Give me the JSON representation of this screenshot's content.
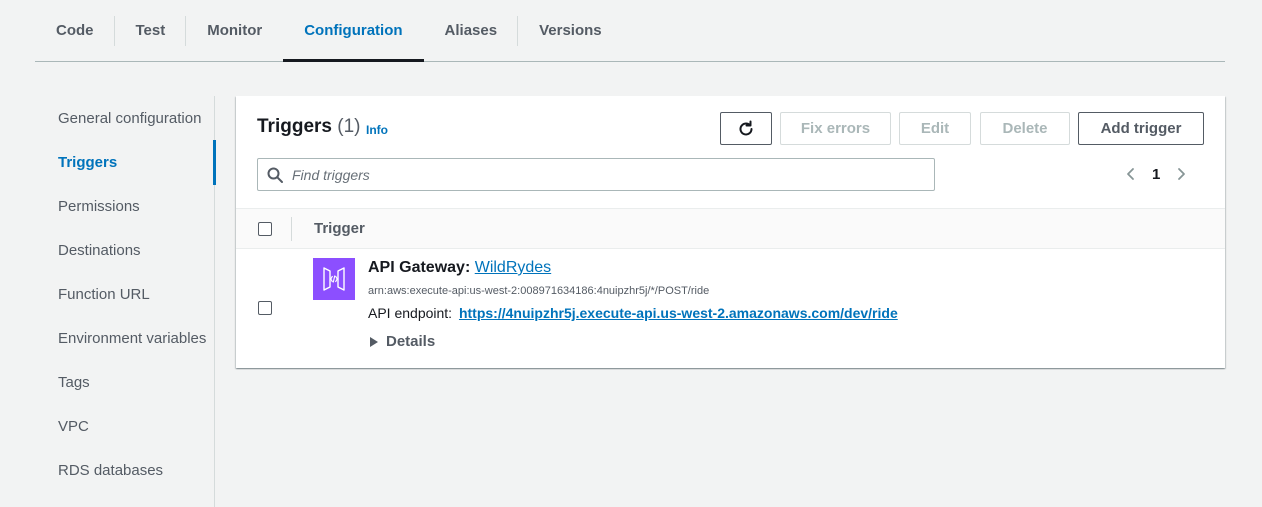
{
  "tabs": [
    {
      "label": "Code",
      "active": false
    },
    {
      "label": "Test",
      "active": false
    },
    {
      "label": "Monitor",
      "active": false
    },
    {
      "label": "Configuration",
      "active": true
    },
    {
      "label": "Aliases",
      "active": false
    },
    {
      "label": "Versions",
      "active": false
    }
  ],
  "sidebar": {
    "items": [
      {
        "label": "General configuration"
      },
      {
        "label": "Triggers",
        "active": true
      },
      {
        "label": "Permissions"
      },
      {
        "label": "Destinations"
      },
      {
        "label": "Function URL"
      },
      {
        "label": "Environment variables"
      },
      {
        "label": "Tags"
      },
      {
        "label": "VPC"
      },
      {
        "label": "RDS databases"
      }
    ]
  },
  "panel": {
    "title": "Triggers",
    "count": "(1)",
    "info": "Info",
    "buttons": {
      "refresh_icon": "refresh-icon",
      "fix_errors": "Fix errors",
      "edit": "Edit",
      "delete": "Delete",
      "add_trigger": "Add trigger"
    },
    "search": {
      "placeholder": "Find triggers",
      "value": ""
    },
    "pagination": {
      "page": "1"
    },
    "table": {
      "column": "Trigger",
      "rows": [
        {
          "type": "API Gateway",
          "name": "WildRydes",
          "arn": "arn:aws:execute-api:us-west-2:008971634186:4nuipzhr5j/*/POST/ride",
          "endpoint_label": "API endpoint:",
          "endpoint_url": "https://4nuipzhr5j.execute-api.us-west-2.amazonaws.com/dev/ride",
          "details": "Details",
          "icon": "api-gateway-icon"
        }
      ]
    }
  },
  "colors": {
    "accent": "#0073bb",
    "api_gateway": "#8c4fff",
    "background": "#f2f3f3"
  }
}
